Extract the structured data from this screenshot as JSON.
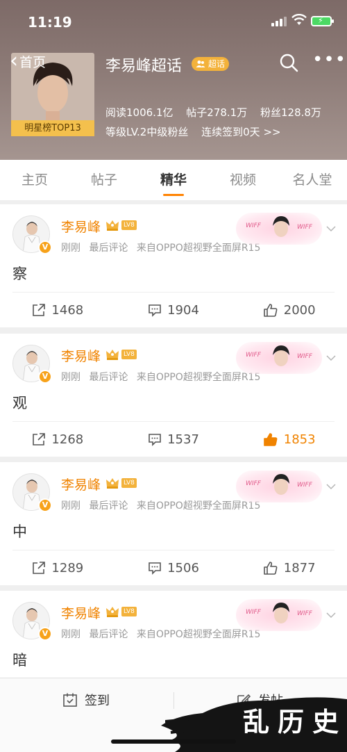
{
  "status": {
    "time": "11:19"
  },
  "header": {
    "back_label": "首页",
    "topic_title": "李易峰超话",
    "badge_label": "超话",
    "rank_label": "明星榜TOP13",
    "stats": {
      "read": "阅读1006.1亿",
      "posts": "帖子278.1万",
      "fans": "粉丝128.8万"
    },
    "level": {
      "grade": "等级LV.2中级粉丝",
      "checkin": "连续签到0天 >>"
    }
  },
  "tabs": [
    {
      "label": "主页"
    },
    {
      "label": "帖子"
    },
    {
      "label": "精华",
      "active": true
    },
    {
      "label": "视频"
    },
    {
      "label": "名人堂"
    }
  ],
  "posts": [
    {
      "name": "李易峰",
      "level": "LV8",
      "time": "刚刚",
      "last": "最后评论",
      "source": "来自OPPO超视野全面屏R15",
      "content": "察",
      "repost": "1468",
      "comment": "1904",
      "like": "2000",
      "liked": false
    },
    {
      "name": "李易峰",
      "level": "LV8",
      "time": "刚刚",
      "last": "最后评论",
      "source": "来自OPPO超视野全面屏R15",
      "content": "观",
      "repost": "1268",
      "comment": "1537",
      "like": "1853",
      "liked": true
    },
    {
      "name": "李易峰",
      "level": "LV8",
      "time": "刚刚",
      "last": "最后评论",
      "source": "来自OPPO超视野全面屏R15",
      "content": "中",
      "repost": "1289",
      "comment": "1506",
      "like": "1877",
      "liked": false
    },
    {
      "name": "李易峰",
      "level": "LV8",
      "time": "刚刚",
      "last": "最后评论",
      "source": "来自OPPO超视野全面屏R15",
      "content": "暗"
    }
  ],
  "bottom": {
    "checkin_label": "签到",
    "post_label": "发帖"
  },
  "watermark": "乱历史",
  "colors": {
    "accent": "#ff8200",
    "name": "#f08300",
    "badge": "#f3b23b"
  }
}
